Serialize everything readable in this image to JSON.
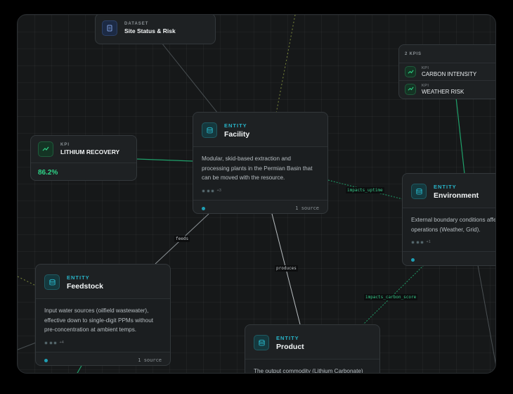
{
  "colors": {
    "canvas_bg": "#161819",
    "node_bg": "#1e2123",
    "accent_teal": "#28b5c9",
    "accent_green": "#2fd488",
    "edge_green": "#1fa06a",
    "edge_gray": "#6f767a",
    "edge_olive": "#7d8a3c"
  },
  "nodes": {
    "dataset": {
      "type": "DATASET",
      "title": "Site Status & Risk",
      "icon": "document-icon"
    },
    "facility": {
      "type": "ENTITY",
      "title": "Facility",
      "icon": "database-icon",
      "description": "Modular, skid-based extraction and processing plants in the Permian Basin that can be moved with the resource.",
      "dots_more": "+3",
      "sources": "1 source"
    },
    "kpi_lithium": {
      "type": "KPI",
      "title": "LITHIUM RECOVERY",
      "value": "86.2%",
      "icon": "trend-up-icon"
    },
    "kpi_group": {
      "header": "2 KPIS",
      "items": [
        {
          "type": "KPI",
          "title": "CARBON INTENSITY",
          "icon": "trend-up-icon"
        },
        {
          "type": "KPI",
          "title": "WEATHER RISK",
          "icon": "trend-up-icon"
        }
      ]
    },
    "environment": {
      "type": "ENTITY",
      "title": "Environment",
      "icon": "database-icon",
      "description": "External boundary conditions affe operations (Weather, Grid).",
      "dots_more": "+1"
    },
    "feedstock": {
      "type": "ENTITY",
      "title": "Feedstock",
      "icon": "database-icon",
      "description": "Input water sources (oilfield wastewater), effective down to single-digit PPMs without pre-concentration at ambient temps.",
      "dots_more": "+4",
      "sources": "1 source"
    },
    "product": {
      "type": "ENTITY",
      "title": "Product",
      "icon": "database-icon",
      "description": "The output commodity (Lithium Carbonate)"
    }
  },
  "edges": {
    "impacts_uptime": "impacts_uptime",
    "feeds": "feeds",
    "produces": "p‍roduces",
    "impacts_carbon_score": "impacts_carbon_score"
  }
}
